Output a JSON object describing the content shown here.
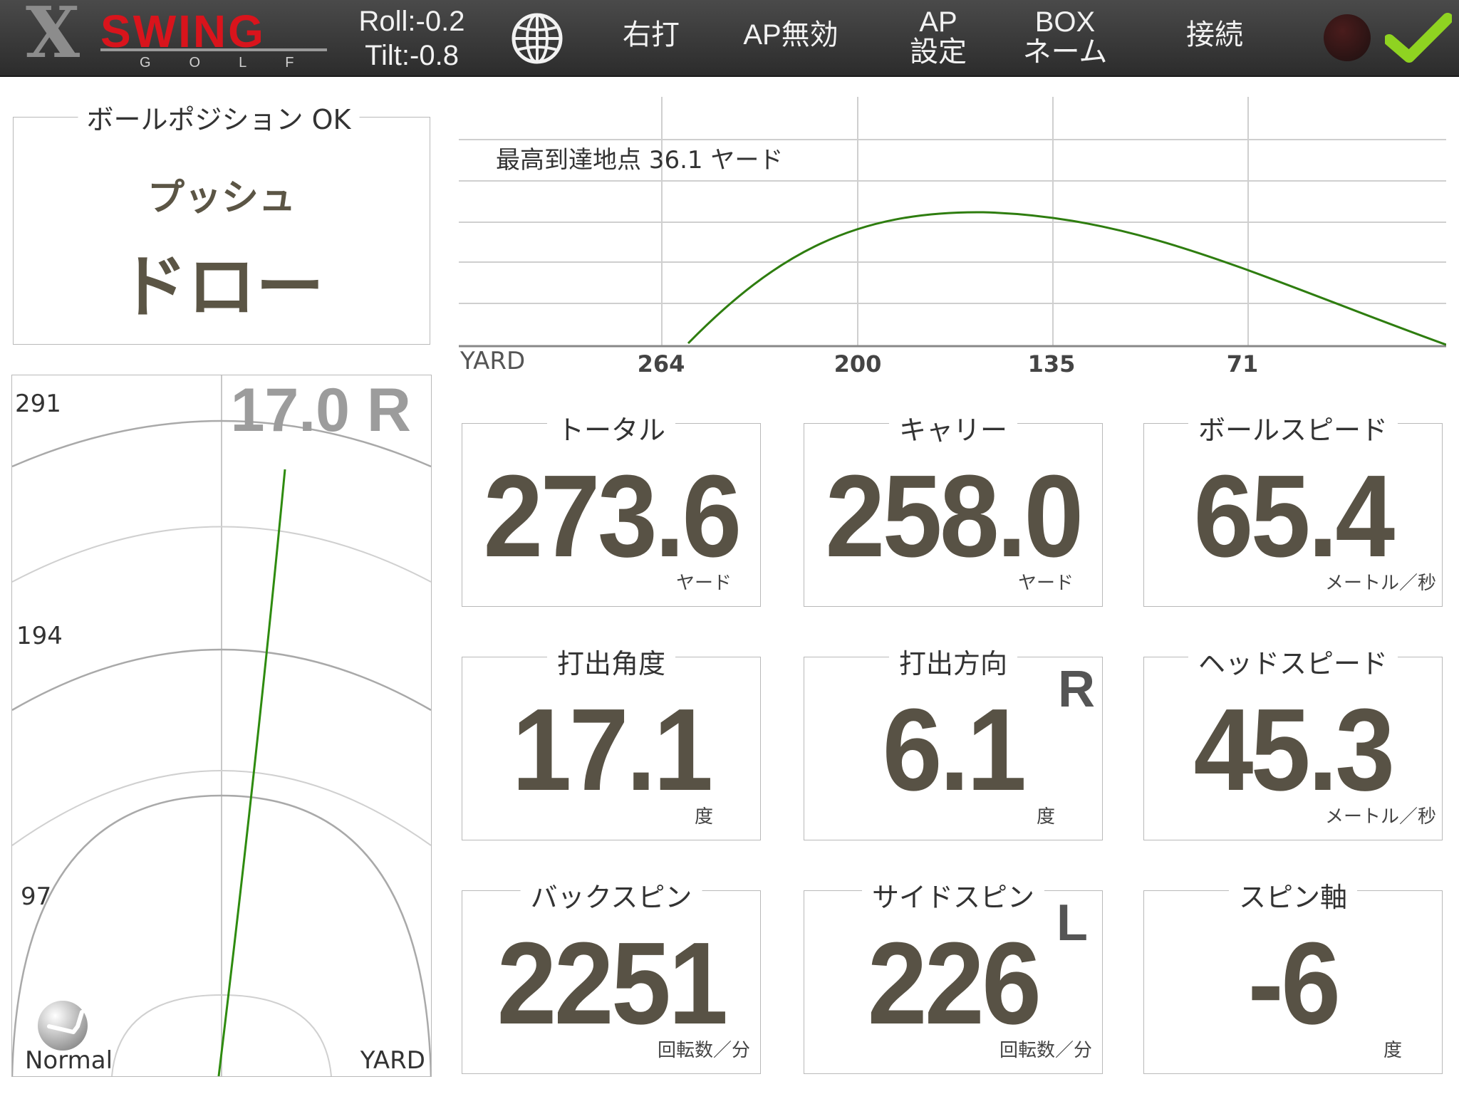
{
  "header": {
    "logo_letter": "X",
    "logo_word": "SWING",
    "logo_sub": "GOLF",
    "roll": "Roll:-0.2",
    "tilt": "Tilt:-0.8",
    "handedness": "右打",
    "ap_disable": "AP無効",
    "ap_settings_line1": "AP",
    "ap_settings_line2": "設定",
    "box_name_line1": "BOX",
    "box_name_line2": "ネーム",
    "connect": "接続"
  },
  "ball_position": {
    "title": "ボールポジション OK",
    "shot_type": "プッシュ",
    "curve": "ドロー"
  },
  "trajectory": {
    "max_height_label": "最高到達地点 36.1 ヤード",
    "axis_label": "YARD",
    "ticks": [
      "264",
      "200",
      "135",
      "71"
    ]
  },
  "top_view": {
    "distances": [
      "291",
      "194",
      "97"
    ],
    "angle_readout": "17.0 R",
    "club_mode": "Normal",
    "axis_label": "YARD"
  },
  "metrics": [
    {
      "title": "トータル",
      "value": "273.6",
      "unit": "ヤード",
      "dir": ""
    },
    {
      "title": "キャリー",
      "value": "258.0",
      "unit": "ヤード",
      "dir": ""
    },
    {
      "title": "ボールスピード",
      "value": "65.4",
      "unit": "メートル／秒",
      "dir": ""
    },
    {
      "title": "打出角度",
      "value": "17.1",
      "unit": "度",
      "dir": ""
    },
    {
      "title": "打出方向",
      "value": "6.1",
      "unit": "度",
      "dir": "R"
    },
    {
      "title": "ヘッドスピード",
      "value": "45.3",
      "unit": "メートル／秒",
      "dir": ""
    },
    {
      "title": "バックスピン",
      "value": "2251",
      "unit": "回転数／分",
      "dir": ""
    },
    {
      "title": "サイドスピン",
      "value": "226",
      "unit": "回転数／分",
      "dir": "L"
    },
    {
      "title": "スピン軸",
      "value": "-6",
      "unit": "度",
      "dir": ""
    }
  ],
  "colors": {
    "topbar": "#333333",
    "logo_red": "#d9141c",
    "trajectory_green": "#2e7d0f",
    "value_text": "#585245",
    "check_green": "#8fd321"
  }
}
